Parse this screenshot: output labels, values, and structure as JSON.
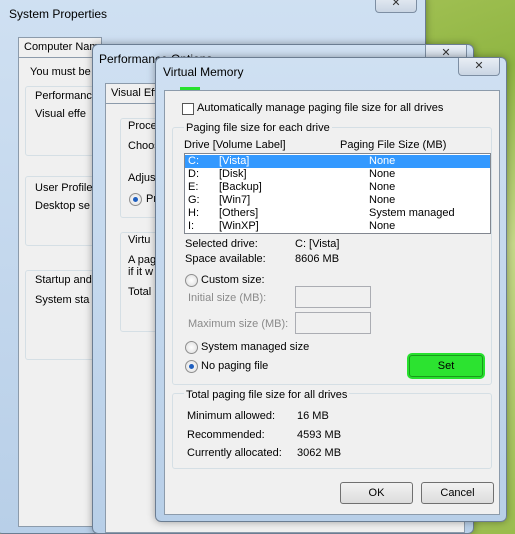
{
  "system_properties": {
    "title": "System Properties",
    "tab_computer_name": "Computer Name",
    "fragment_admin": "You must be",
    "fragment_performance": "Performanc",
    "fragment_visual_effects": "Visual effe",
    "fragment_user_profiles": "User Profile",
    "fragment_desktop_settings": "Desktop se",
    "fragment_startup": "Startup and",
    "fragment_system_startup": "System sta"
  },
  "performance_options": {
    "title": "Performance Options",
    "tab_visual_effects": "Visual Effe",
    "fragment_processor": "Proces",
    "fragment_choose": "Choos",
    "fragment_adjust": "Adjus",
    "fragment_programs": "Pr",
    "fragment_virtual": "Virtu",
    "fragment_paging_line1": "A pag",
    "fragment_paging_line2": "if it w",
    "fragment_total": "Total"
  },
  "virtual_memory": {
    "title": "Virtual Memory",
    "auto_manage_label": "Automatically manage paging file size for all drives",
    "auto_manage_checked": false,
    "group_paging_title": "Paging file size for each drive",
    "col_drive": "Drive  [Volume Label]",
    "col_size": "Paging File Size (MB)",
    "drives": [
      {
        "letter": "C:",
        "label": "[Vista]",
        "size": "None",
        "selected": true
      },
      {
        "letter": "D:",
        "label": "[Disk]",
        "size": "None",
        "selected": false
      },
      {
        "letter": "E:",
        "label": "[Backup]",
        "size": "None",
        "selected": false
      },
      {
        "letter": "G:",
        "label": "[Win7]",
        "size": "None",
        "selected": false
      },
      {
        "letter": "H:",
        "label": "[Others]",
        "size": "System managed",
        "selected": false
      },
      {
        "letter": "I:",
        "label": "[WinXP]",
        "size": "None",
        "selected": false
      }
    ],
    "selected_drive_label": "Selected drive:",
    "selected_drive_value": "C:  [Vista]",
    "space_available_label": "Space available:",
    "space_available_value": "8606 MB",
    "custom_size_label": "Custom size:",
    "initial_size_label": "Initial size (MB):",
    "maximum_size_label": "Maximum size (MB):",
    "system_managed_label": "System managed size",
    "no_paging_label": "No paging file",
    "selected_option": "no_paging",
    "set_button": "Set",
    "group_total_title": "Total paging file size for all drives",
    "minimum_label": "Minimum allowed:",
    "minimum_value": "16 MB",
    "recommended_label": "Recommended:",
    "recommended_value": "4593 MB",
    "allocated_label": "Currently allocated:",
    "allocated_value": "3062 MB",
    "ok_button": "OK",
    "cancel_button": "Cancel"
  },
  "colors": {
    "highlight": "#27e12e",
    "selection": "#3399ff"
  }
}
